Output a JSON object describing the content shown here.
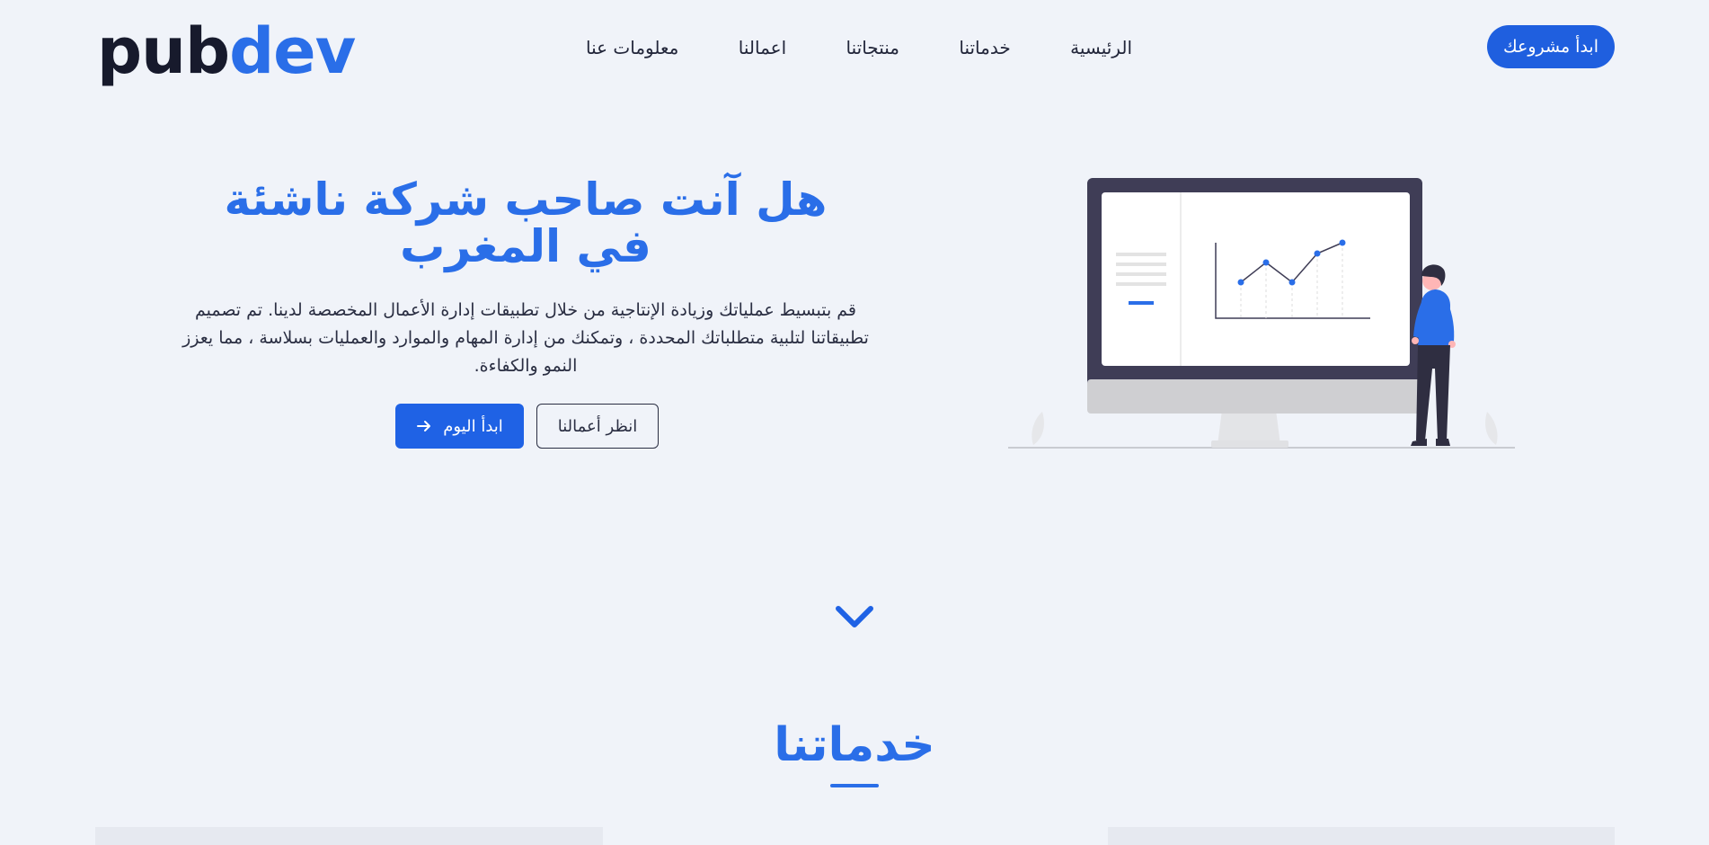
{
  "header": {
    "logo_part1": "pub",
    "logo_part2": "dev",
    "nav": [
      "الرئيسية",
      "خدماتنا",
      "منتجاتنا",
      "اعمالنا",
      "معلومات عنا"
    ],
    "cta": "ابدأ مشروعك"
  },
  "hero": {
    "title": "هل آنت صاحب شركة ناشئة في المغرب",
    "description": "قم بتبسيط عملياتك وزيادة الإنتاجية من خلال تطبيقات إدارة الأعمال المخصصة لدينا. تم تصميم تطبيقاتنا لتلبية متطلباتك المحددة ، وتمكنك من إدارة المهام والموارد والعمليات بسلاسة ، مما يعزز النمو والكفاءة.",
    "btn_start": "ابدأ اليوم",
    "btn_works": "انظر أعمالنا"
  },
  "services": {
    "title": "خدماتنا"
  },
  "colors": {
    "primary": "#1f62e5",
    "heading": "#2a6ee8",
    "background": "#f0f3f9",
    "dark": "#171a2c"
  },
  "icons": {
    "arrow": "arrow-right-icon",
    "scroll": "chevron-down-icon"
  }
}
